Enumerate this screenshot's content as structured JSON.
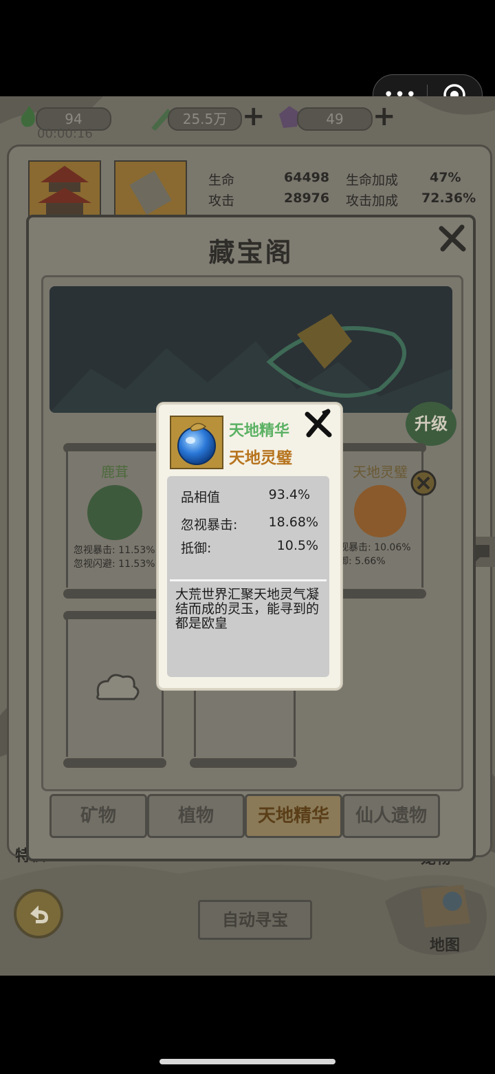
{
  "top_bar": {
    "menu_dots": "•••"
  },
  "resources": {
    "stamina": "94",
    "timer": "00:00:16",
    "currency": "25.5万",
    "gems": "49"
  },
  "stats": {
    "hp_label": "生命",
    "hp_value": "64498",
    "hp_bonus_label": "生命加成",
    "hp_bonus_value": "47%",
    "atk_label": "攻击",
    "atk_value": "28976",
    "atk_bonus_label": "攻击加成",
    "atk_bonus_value": "72.36%"
  },
  "modal": {
    "title": "藏宝阁",
    "upgrade_label": "升级",
    "slots": [
      {
        "name": "鹿茸",
        "stat1": "忽视暴击: 11.53%",
        "stat2": "忽视闪避: 11.53%"
      },
      {
        "name": "天地灵璧",
        "stat1": "视暴击: 10.06%",
        "stat2": "御:       5.66%"
      }
    ],
    "tabs": [
      "矿物",
      "植物",
      "天地精华",
      "仙人遗物"
    ],
    "active_tab_index": 2
  },
  "popup": {
    "category": "天地精华",
    "item_name": "天地灵璧",
    "rows": [
      {
        "label": "品相值",
        "value": "93.4%"
      },
      {
        "label": "忽视暴击:",
        "value": "18.68%"
      },
      {
        "label": "抵御:",
        "value": "10.5%"
      }
    ],
    "description": "大荒世界汇聚天地灵气凝结而成的灵玉，能寻到的都是欧皇"
  },
  "bottom": {
    "auto_search_label": "自动寻宝",
    "map_label": "地图",
    "left_side_label": "特权",
    "right_side_label": "宠物"
  },
  "colors": {
    "category_green": "#5bb163",
    "item_gold": "#b6731d"
  }
}
